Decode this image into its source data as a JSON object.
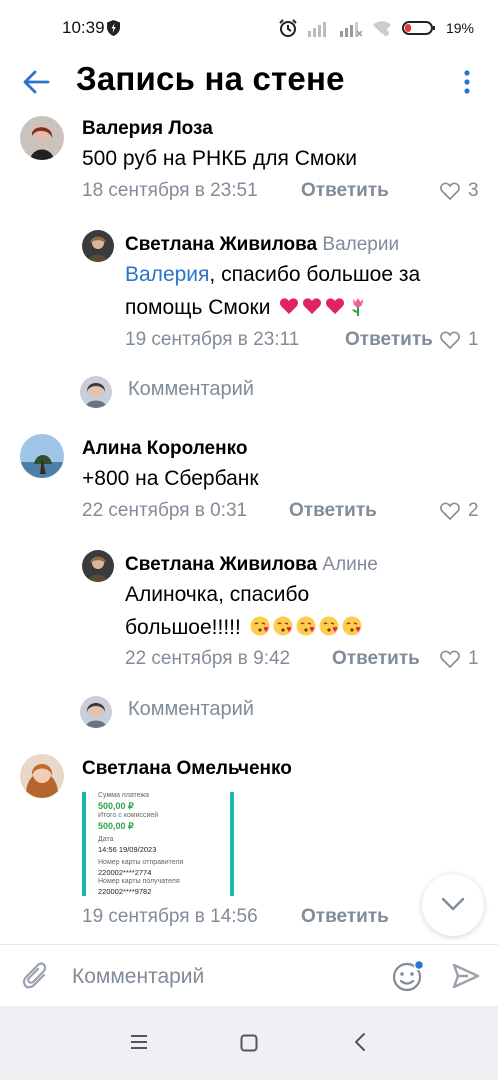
{
  "status_bar": {
    "time": "10:39",
    "battery": "19%"
  },
  "header": {
    "title": "Запись на стене"
  },
  "comments": [
    {
      "author": "Валерия Лоза",
      "text": "500 руб на РНКБ для Смоки",
      "date": "18 сентября в 23:51",
      "reply_label": "Ответить",
      "likes": "3",
      "replies": [
        {
          "author": "Светлана Живилова",
          "reply_to": "Валерии",
          "mention": "Валерия",
          "text": ", спасибо большое за помощь Смоки",
          "date": "19 сентября в 23:11",
          "reply_label": "Ответить",
          "likes": "1"
        }
      ],
      "comment_prompt": "Комментарий"
    },
    {
      "author": "Алина Короленко",
      "text": "+800 на Сбербанк",
      "date": "22 сентября в 0:31",
      "reply_label": "Ответить",
      "likes": "2",
      "replies": [
        {
          "author": "Светлана Живилова",
          "reply_to": "Алине",
          "text": "Алиночка, спасибо большое!!!!!",
          "date": "22 сентября в 9:42",
          "reply_label": "Ответить",
          "likes": "1"
        }
      ],
      "comment_prompt": "Комментарий"
    },
    {
      "author": "Светлана Омельченко",
      "date": "19 сентября в 14:56",
      "reply_label": "Ответить",
      "attachment": {
        "lines": [
          "Сумма платежа",
          "500,00 ₽",
          "Итого с комиссией",
          "500,00 ₽",
          "Дата",
          "14:56 19/09/2023",
          "Номер карты отправителя",
          "220002****2774",
          "Номер карты получателя",
          "220002****9782"
        ]
      }
    }
  ],
  "composer": {
    "placeholder": "Комментарий"
  },
  "colors": {
    "accent": "#2a73cc",
    "secondary_text": "#818c99",
    "heart": "#e0245e",
    "receipt_border": "#1fb5b0"
  }
}
